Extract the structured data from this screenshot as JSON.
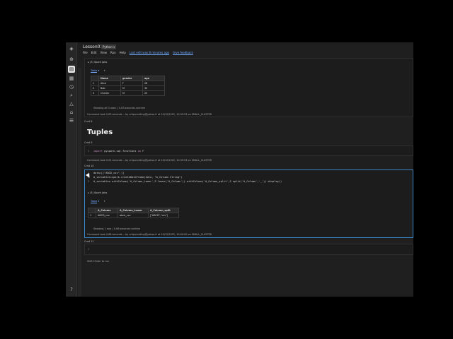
{
  "header": {
    "title": "Lesson01",
    "language": "Python",
    "menu": [
      "File",
      "Edit",
      "View",
      "Run",
      "Help"
    ],
    "last_edit": "Last edit was 8 minutes ago",
    "feedback": "Give feedback"
  },
  "cell1": {
    "spark_jobs": "▸ (3) Spark Jobs",
    "tab": "Table",
    "plus": "+",
    "columns": [
      "",
      "Name",
      "gender",
      "age"
    ],
    "rows": [
      [
        "1",
        "Alice",
        "F",
        "28"
      ],
      [
        "2",
        "Bob",
        "M",
        "30"
      ],
      [
        "3",
        "Charlie",
        "M",
        "25"
      ]
    ],
    "showing": "Showing all 3 rows.  |  0.83 seconds runtime",
    "footer": "Command took 0.83 seconds -- by critpurcelling@yahoo.fr at 10/12/2022, 10:39:53 on SMALL_CLUSTER"
  },
  "cmd8": {
    "label": "Cmd 8"
  },
  "heading": {
    "text": "Tuples"
  },
  "cmd9": {
    "label": "Cmd 9",
    "line_num": "1",
    "kw": "import",
    "code": " pyspark.sql.functions ",
    "as": "as",
    "alias": " F",
    "footer": "Command took 0.02 seconds -- by critpurcelling@yahoo.fr at 10/12/2022, 10:39:53 on SMALL_CLUSTER"
  },
  "cmd10": {
    "label": "Cmd 10",
    "lines": [
      {
        "n": "1",
        "text": "data=[(\"ABCD_csv\",)]"
      },
      {
        "n": "2",
        "text": "A_variables=spark.createDataFrame(data, \"A_Column String\")"
      },
      {
        "n": "3",
        "text": "A_variables.withColumn('A_Column_Lower',F.lower('A_Column')).withColumn('A_Column_split',F.split('A_Column','_')).display()"
      }
    ],
    "spark_jobs": "▸ (3) Spark Jobs",
    "tab": "Table",
    "plus": "+",
    "columns": [
      "",
      "A_Column",
      "A_Column_Lower",
      "A_Column_split"
    ],
    "rows": [
      [
        "1",
        "ABCD_csv",
        "abcd_csv",
        "[\"ABCD\",\"csv\"]"
      ]
    ],
    "showing": "Showing 1 row.  |  0.66 seconds runtime",
    "footer": "Command took 0.66 seconds -- by critpurcelling@yahoo.fr at 10/12/2022, 10:40:00 on SMALL_CLUSTER"
  },
  "cmd11": {
    "label": "Cmd 11",
    "line_num": "1"
  },
  "hint": "Shift+Enter to run"
}
